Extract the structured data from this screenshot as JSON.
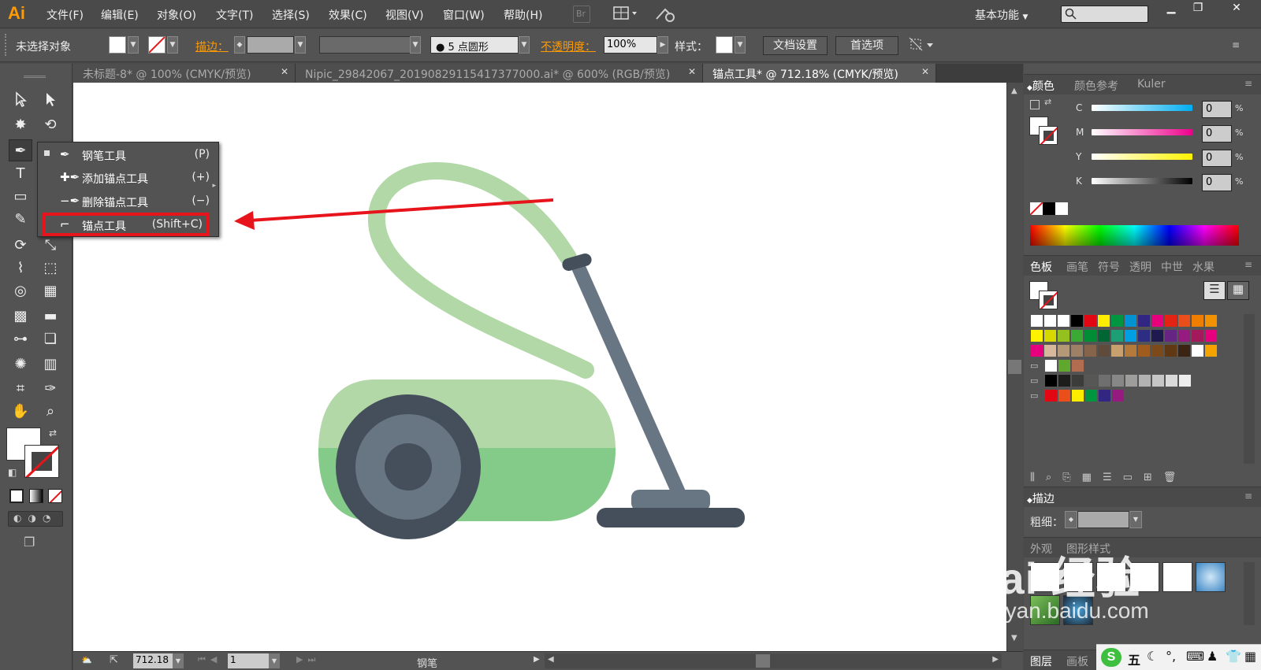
{
  "menubar": {
    "logo": "Ai",
    "items": [
      "文件(F)",
      "编辑(E)",
      "对象(O)",
      "文字(T)",
      "选择(S)",
      "效果(C)",
      "视图(V)",
      "窗口(W)",
      "帮助(H)"
    ],
    "br_label": "Br",
    "workspace": "基本功能"
  },
  "control": {
    "selection": "未选择对象",
    "stroke_label": "描边：",
    "brush": "5 点圆形",
    "opacity_label": "不透明度：",
    "opacity": "100%",
    "style_label": "样式：",
    "doc_setup": "文档设置",
    "prefs": "首选项"
  },
  "tabs": [
    {
      "label": "未标题-8* @ 100% (CMYK/预览)",
      "active": false
    },
    {
      "label": "Nipic_29842067_20190829115417377000.ai* @ 600% (RGB/预览)",
      "active": false
    },
    {
      "label": "锚点工具* @ 712.18% (CMYK/预览)",
      "active": true
    }
  ],
  "flyout": {
    "items": [
      {
        "label": "钢笔工具",
        "key": "(P)"
      },
      {
        "label": "添加锚点工具",
        "key": "(+)"
      },
      {
        "label": "删除锚点工具",
        "key": "(−)"
      },
      {
        "label": "锚点工具",
        "key": "(Shift+C)"
      }
    ]
  },
  "status": {
    "zoom": "712.18",
    "page": "1",
    "tool": "钢笔"
  },
  "color_panel": {
    "tabs": [
      "颜色",
      "颜色参考",
      "Kuler"
    ],
    "channels": [
      {
        "name": "C",
        "value": "0"
      },
      {
        "name": "M",
        "value": "0"
      },
      {
        "name": "Y",
        "value": "0"
      },
      {
        "name": "K",
        "value": "0"
      }
    ],
    "pct": "%"
  },
  "swatches_panel": {
    "tabs": [
      "色板",
      "画笔",
      "符号",
      "透明",
      "中世",
      "水果"
    ]
  },
  "stroke_panel": {
    "title": "描边",
    "weight_label": "粗细："
  },
  "appearance_panel": {
    "tabs": [
      "外观",
      "图形样式"
    ]
  },
  "layers_panel": {
    "tabs": [
      "图层",
      "画板"
    ]
  },
  "watermark": {
    "brand": "Bai 经验",
    "url": "jingyan.baidu.com"
  },
  "ime": {
    "label": "五"
  },
  "colors": {
    "accent": "#ff9a00",
    "highlight_red": "#e8141b",
    "vacuum_light_green": "#b1d8a6",
    "vacuum_green": "#84cb8a",
    "wheel_dark": "#454f5b",
    "wheel_mid": "#687583"
  }
}
